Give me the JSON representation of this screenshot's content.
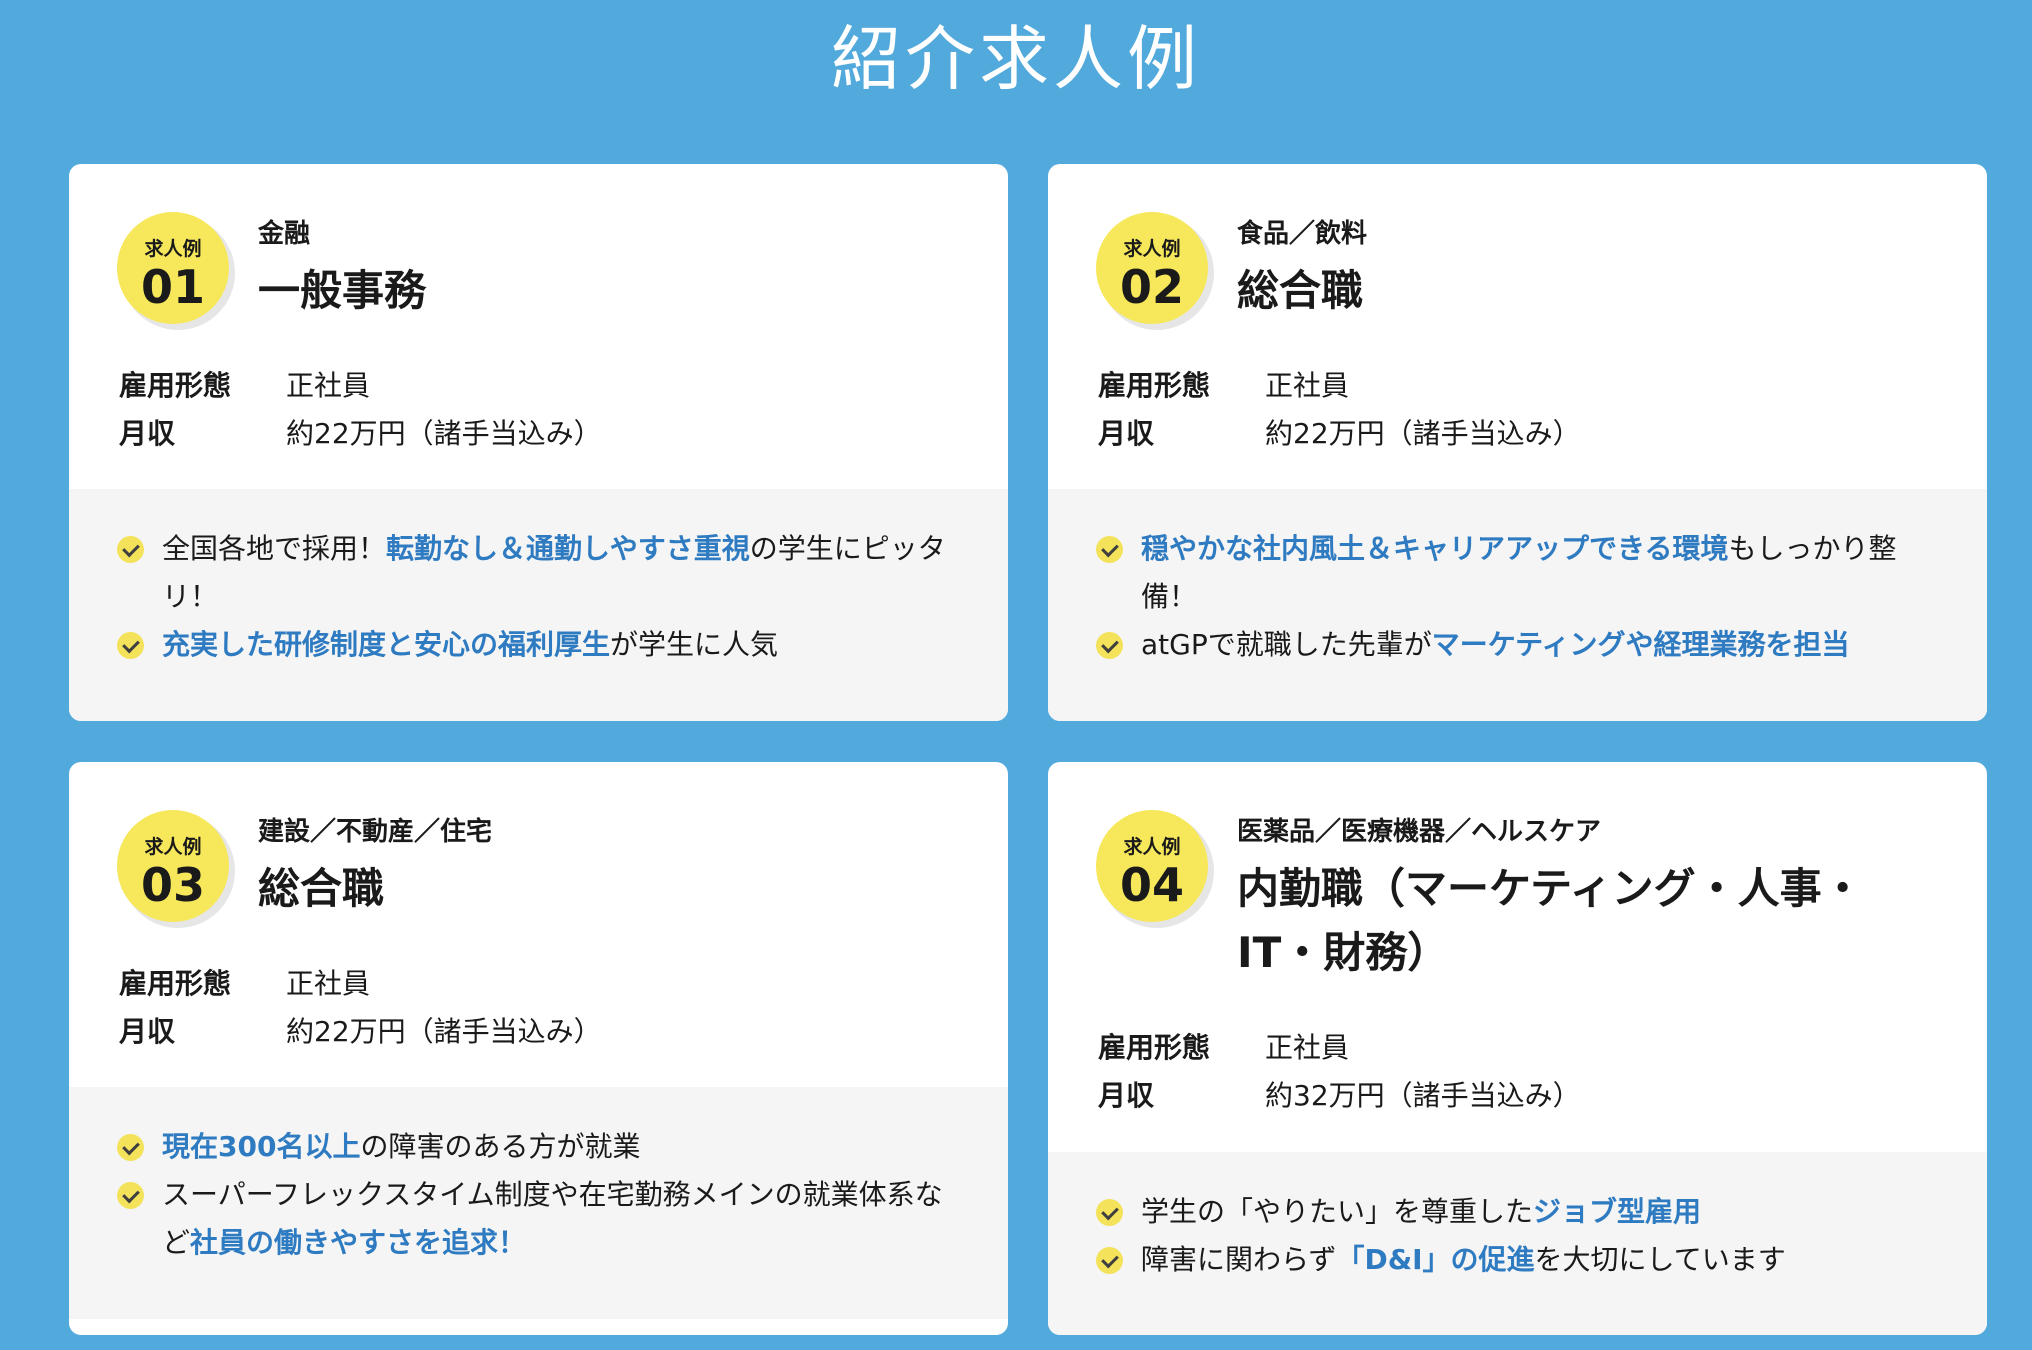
{
  "page": {
    "title": "紹介求人例"
  },
  "cards": [
    {
      "badge_label": "求人例",
      "badge_number": "01",
      "industry": "金融",
      "job_title": "一般事務",
      "employment_label": "雇用形態",
      "employment_value": "正社員",
      "salary_label": "月収",
      "salary_value": "約22万円（諸手当込み）",
      "points": [
        {
          "before": "全国各地で採用！",
          "highlight": "転勤なし＆通勤しやすさ重視",
          "after": "の学生にピッタリ！"
        },
        {
          "before": "",
          "highlight": "充実した研修制度と安心の福利厚生",
          "after": "が学生に人気"
        }
      ]
    },
    {
      "badge_label": "求人例",
      "badge_number": "02",
      "industry": "食品／飲料",
      "job_title": "総合職",
      "employment_label": "雇用形態",
      "employment_value": "正社員",
      "salary_label": "月収",
      "salary_value": "約22万円（諸手当込み）",
      "points": [
        {
          "before": "",
          "highlight": "穏やかな社内風土＆キャリアアップできる環境",
          "after": "もしっかり整備！"
        },
        {
          "before": "atGPで就職した先輩が",
          "highlight": "マーケティングや経理業務を担当",
          "after": ""
        }
      ]
    },
    {
      "badge_label": "求人例",
      "badge_number": "03",
      "industry": "建設／不動産／住宅",
      "job_title": "総合職",
      "employment_label": "雇用形態",
      "employment_value": "正社員",
      "salary_label": "月収",
      "salary_value": "約22万円（諸手当込み）",
      "points": [
        {
          "before": "",
          "highlight": "現在300名以上",
          "after": "の障害のある方が就業"
        },
        {
          "before": "スーパーフレックスタイム制度や在宅勤務メインの就業体系など",
          "highlight": "社員の働きやすさを追求！",
          "after": ""
        }
      ]
    },
    {
      "badge_label": "求人例",
      "badge_number": "04",
      "industry": "医薬品／医療機器／ヘルスケア",
      "job_title": "内勤職（マーケティング・人事・IT・財務）",
      "employment_label": "雇用形態",
      "employment_value": "正社員",
      "salary_label": "月収",
      "salary_value": "約32万円（諸手当込み）",
      "points": [
        {
          "before": "学生の「やりたい」を尊重した",
          "highlight": "ジョブ型雇用",
          "after": ""
        },
        {
          "before": "障害に関わらず",
          "highlight": "「D&I」の促進",
          "after": "を大切にしています"
        }
      ]
    }
  ]
}
